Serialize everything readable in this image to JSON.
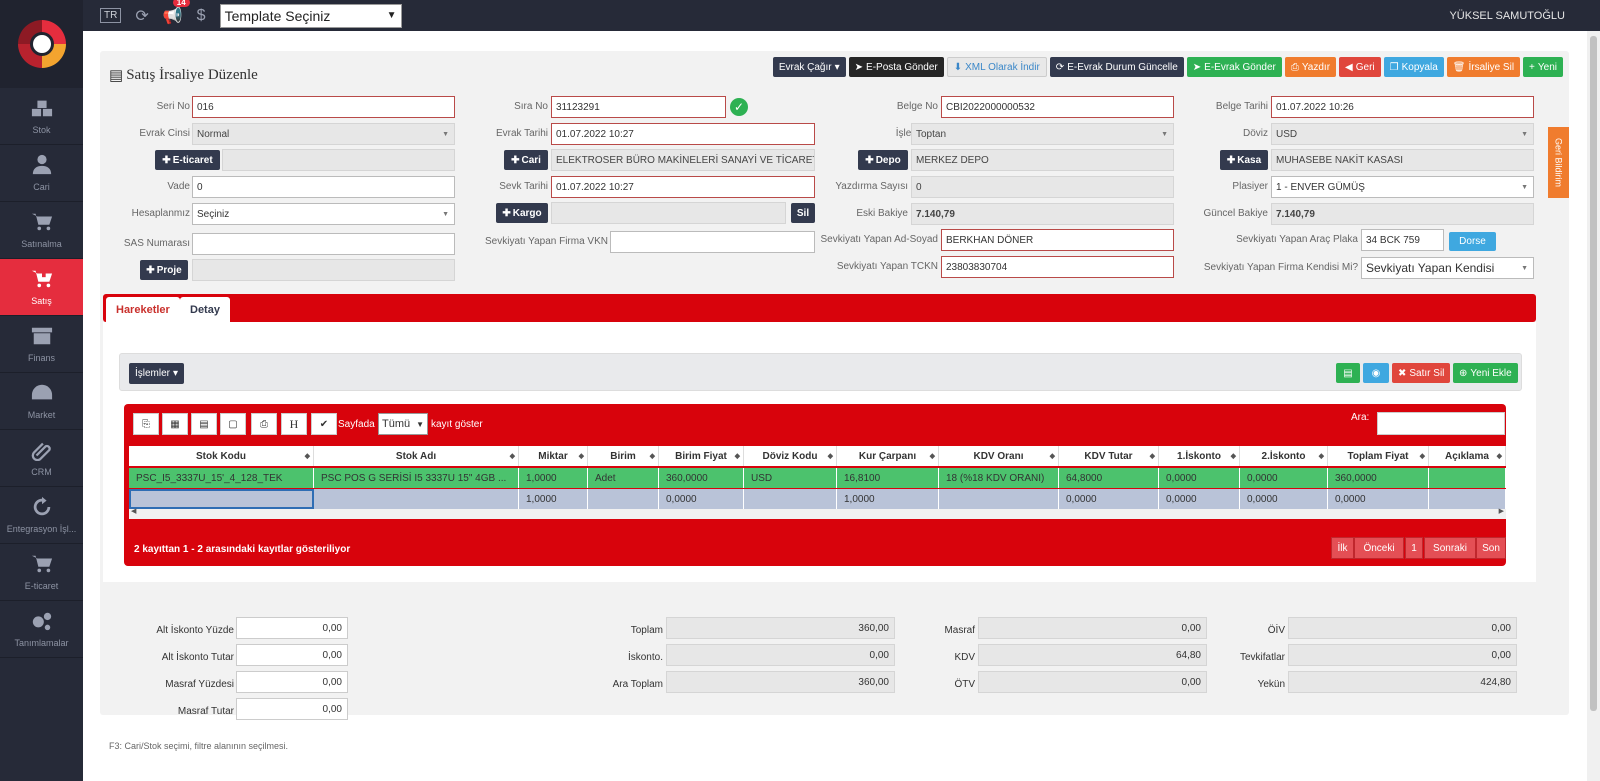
{
  "nav": [
    {
      "label": "Stok",
      "icon": "cubes-icon"
    },
    {
      "label": "Cari",
      "icon": "user-icon"
    },
    {
      "label": "Satınalma",
      "icon": "cart-down-icon"
    },
    {
      "label": "Satış",
      "icon": "cart-up-icon"
    },
    {
      "label": "Finans",
      "icon": "archive-icon"
    },
    {
      "label": "Market",
      "icon": "dashboard-icon"
    },
    {
      "label": "CRM",
      "icon": "paperclip-icon"
    },
    {
      "label": "Entegrasyon İşl...",
      "icon": "refresh-icon"
    },
    {
      "label": "E-ticaret",
      "icon": "shopping-cart-icon"
    },
    {
      "label": "Tanımlamalar",
      "icon": "gears-icon"
    }
  ],
  "topbar": {
    "lang": "TR",
    "notif_count": "14",
    "template": "Template Seçiniz",
    "user": "YÜKSEL SAMUTOĞLU"
  },
  "page": {
    "title": "Satış İrsaliye Düzenle",
    "footer_hint": "F3: Cari/Stok seçimi, filtre alanının seçilmesi."
  },
  "actions": {
    "evrak_cagir": "Evrak Çağır",
    "eposta": "E-Posta Gönder",
    "xml": "XML Olarak İndir",
    "edurum": "E-Evrak Durum Güncelle",
    "egonder": "E-Evrak Gönder",
    "yazdir": "Yazdır",
    "geri": "Geri",
    "kopyala": "Kopyala",
    "sil": "İrsaliye Sil",
    "yeni": "Yeni"
  },
  "form": {
    "seri_no_label": "Seri No",
    "seri_no": "016",
    "evrak_cinsi_label": "Evrak Cinsi",
    "evrak_cinsi": "Normal",
    "eticaret_btn": "E-ticaret",
    "vade_label": "Vade",
    "vade": "0",
    "hesaplanmiz_label": "Hesaplanmız",
    "hesaplanmiz": "Seçiniz",
    "sas_label": "SAS Numarası",
    "proje_btn": "Proje",
    "sira_no_label": "Sıra No",
    "sira_no": "31123291",
    "evrak_tarihi_label": "Evrak Tarihi",
    "evrak_tarihi": "01.07.2022 10:27",
    "cari_btn": "Cari",
    "cari": "ELEKTROSER BÜRO MAKİNELERİ SANAYİ VE TİCARET",
    "sevk_tarihi_label": "Sevk Tarihi",
    "sevk_tarihi": "01.07.2022 10:27",
    "kargo_btn": "Kargo",
    "kargo_sil": "Sil",
    "firma_vkn_label": "Sevkiyatı Yapan Firma VKN",
    "belge_no_label": "Belge No",
    "belge_no": "CBI2022000000532",
    "islem_tipi_label": "İşlem Tipi",
    "islem_tipi": "Toptan",
    "depo_btn": "Depo",
    "depo": "MERKEZ DEPO",
    "yazdirma_label": "Yazdırma Sayısı",
    "yazdirma": "0",
    "eski_bakiye_label": "Eski Bakiye",
    "eski_bakiye": "7.140,79",
    "adsoyad_label": "Sevkiyatı Yapan Ad-Soyad",
    "adsoyad": "BERKHAN DÖNER",
    "tckn_label": "Sevkiyatı Yapan TCKN",
    "tckn": "23803830704",
    "belge_tarihi_label": "Belge Tarihi",
    "belge_tarihi": "01.07.2022 10:26",
    "doviz_label": "Döviz",
    "doviz": "USD",
    "kasa_btn": "Kasa",
    "kasa": "MUHASEBE NAKİT KASASI",
    "plasiyer_label": "Plasiyer",
    "plasiyer": "1 - ENVER GÜMÜŞ",
    "guncel_bakiye_label": "Güncel Bakiye",
    "guncel_bakiye": "7.140,79",
    "plaka_label": "Sevkiyatı Yapan Araç Plaka",
    "plaka": "34 BCK 759",
    "dorse_btn": "Dorse",
    "kendisi_label": "Sevkiyatı Yapan Firma Kendisi Mi?",
    "kendisi": "Sevkiyatı Yapan Kendisi",
    "geri_bildirim": "Geri Bildirim"
  },
  "tabs": [
    "Hareketler",
    "Detay"
  ],
  "ops": {
    "islemler": "İşlemler",
    "satir_sil": "Satır Sil",
    "yeni_ekle": "Yeni Ekle"
  },
  "grid": {
    "sayfada": "Sayfada",
    "length": "Tümü",
    "kayit": "kayıt göster",
    "ara": "Ara:",
    "columns": [
      "Stok Kodu",
      "Stok Adı",
      "Miktar",
      "Birim",
      "Birim Fiyat",
      "Döviz Kodu",
      "Kur Çarpanı",
      "KDV Oranı",
      "KDV Tutar",
      "1.İskonto",
      "2.İskonto",
      "Toplam Fiyat",
      "Açıklama"
    ],
    "rows": [
      [
        "PSC_I5_3337U_15'_4_128_TEK",
        "PSC POS G SERİSİ I5 3337U 15\" 4GB ...",
        "1,0000",
        "Adet",
        "360,0000",
        "USD",
        "16,8100",
        "18 (%18 KDV ORANI)",
        "64,8000",
        "0,0000",
        "0,0000",
        "360,0000",
        ""
      ],
      [
        "",
        "",
        "1,0000",
        "",
        "0,0000",
        "",
        "1,0000",
        "",
        "0,0000",
        "0,0000",
        "0,0000",
        "0,0000",
        ""
      ]
    ],
    "info": "2 kayıttan 1 - 2 arasındaki kayıtlar gösteriliyor",
    "pager": [
      "İlk",
      "Önceki",
      "1",
      "Sonraki",
      "Son"
    ]
  },
  "totals": {
    "alt_iskonto_yuzde_label": "Alt İskonto Yüzde",
    "alt_iskonto_yuzde": "0,00",
    "alt_iskonto_tutar_label": "Alt İskonto Tutar",
    "alt_iskonto_tutar": "0,00",
    "masraf_yuzdesi_label": "Masraf Yüzdesi",
    "masraf_yuzdesi": "0,00",
    "masraf_tutar_label": "Masraf Tutar",
    "masraf_tutar": "0,00",
    "toplam_label": "Toplam",
    "toplam": "360,00",
    "iskonto_label": "İskonto.",
    "iskonto": "0,00",
    "ara_toplam_label": "Ara Toplam",
    "ara_toplam": "360,00",
    "masraf_label": "Masraf",
    "masraf": "0,00",
    "kdv_label": "KDV",
    "kdv": "64,80",
    "otv_label": "ÖTV",
    "otv": "0,00",
    "oiv_label": "ÖİV",
    "oiv": "0,00",
    "tevkifat_label": "Tevkifatlar",
    "tevkifat": "0,00",
    "yekun_label": "Yekün",
    "yekun": "424,80"
  }
}
